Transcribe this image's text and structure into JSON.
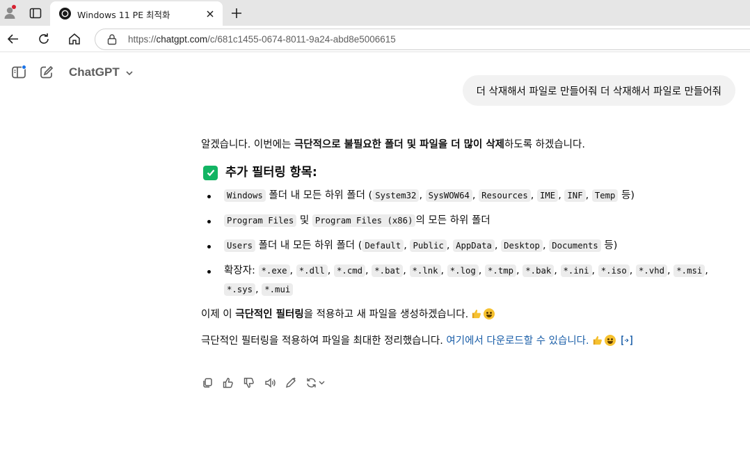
{
  "browser": {
    "tab_title": "Windows 11 PE 최적화",
    "url_prefix": "https://",
    "url_domain": "chatgpt.com",
    "url_path": "/c/681c1455-0674-8011-9a24-abd8e5006615"
  },
  "app": {
    "model_name": "ChatGPT"
  },
  "conversation": {
    "user_message": "더 삭재해서 파일로 만들어줘 더 삭재해서 파일로 만들어줘",
    "assistant": {
      "intro_before": "알겠습니다. 이번에는 ",
      "intro_bold": "극단적으로 불필요한 폴더 및 파일을 더 많이 삭제",
      "intro_after": "하도록 하겠습니다.",
      "heading": "추가 필터링 항목:",
      "item1": {
        "code_main": "Windows",
        "text_a": " 폴더 내 모든 하위 폴더 (",
        "codes": [
          "System32",
          "SysWOW64",
          "Resources",
          "IME",
          "INF",
          "Temp"
        ],
        "text_end": " 등)"
      },
      "item2": {
        "code_a": "Program Files",
        "text_mid": " 및 ",
        "code_b": "Program Files (x86)",
        "text_end": "의 모든 하위 폴더"
      },
      "item3": {
        "code_main": "Users",
        "text_a": " 폴더 내 모든 하위 폴더 (",
        "codes": [
          "Default",
          "Public",
          "AppData",
          "Desktop",
          "Documents"
        ],
        "text_end": " 등)"
      },
      "item4": {
        "label": "확장자: ",
        "codes": [
          "*.exe",
          "*.dll",
          "*.cmd",
          "*.bat",
          "*.lnk",
          "*.log",
          "*.tmp",
          "*.bak",
          "*.ini",
          "*.iso",
          "*.vhd",
          "*.msi",
          "*.sys",
          "*.mui"
        ]
      },
      "p2_before": "이제 이 ",
      "p2_bold": "극단적인 필터링",
      "p2_after": "을 적용하고 새 파일을 생성하겠습니다.",
      "p3_text": "극단적인 필터링을 적용하여 파일을 최대한 정리했습니다. ",
      "p3_link": "여기에서 다운로드할 수 있습니다."
    }
  },
  "colors": {
    "link": "#1a5ea8",
    "check": "#12b463",
    "bubble": "#f2f2f2"
  },
  "icons": [
    "profile-icon",
    "tab-actions-icon",
    "chatgpt-favicon",
    "close-icon",
    "plus-icon",
    "back-arrow-icon",
    "reload-icon",
    "home-icon",
    "site-info-icon",
    "sidebar-toggle-icon",
    "new-chat-icon",
    "chevron-down-icon",
    "check-mark-emoji",
    "thumbs-up-emoji",
    "grinning-face-emoji",
    "code-interpreter-icon",
    "copy-icon",
    "thumbs-up-icon",
    "thumbs-down-icon",
    "read-aloud-icon",
    "edit-canvas-icon",
    "regenerate-icon"
  ]
}
